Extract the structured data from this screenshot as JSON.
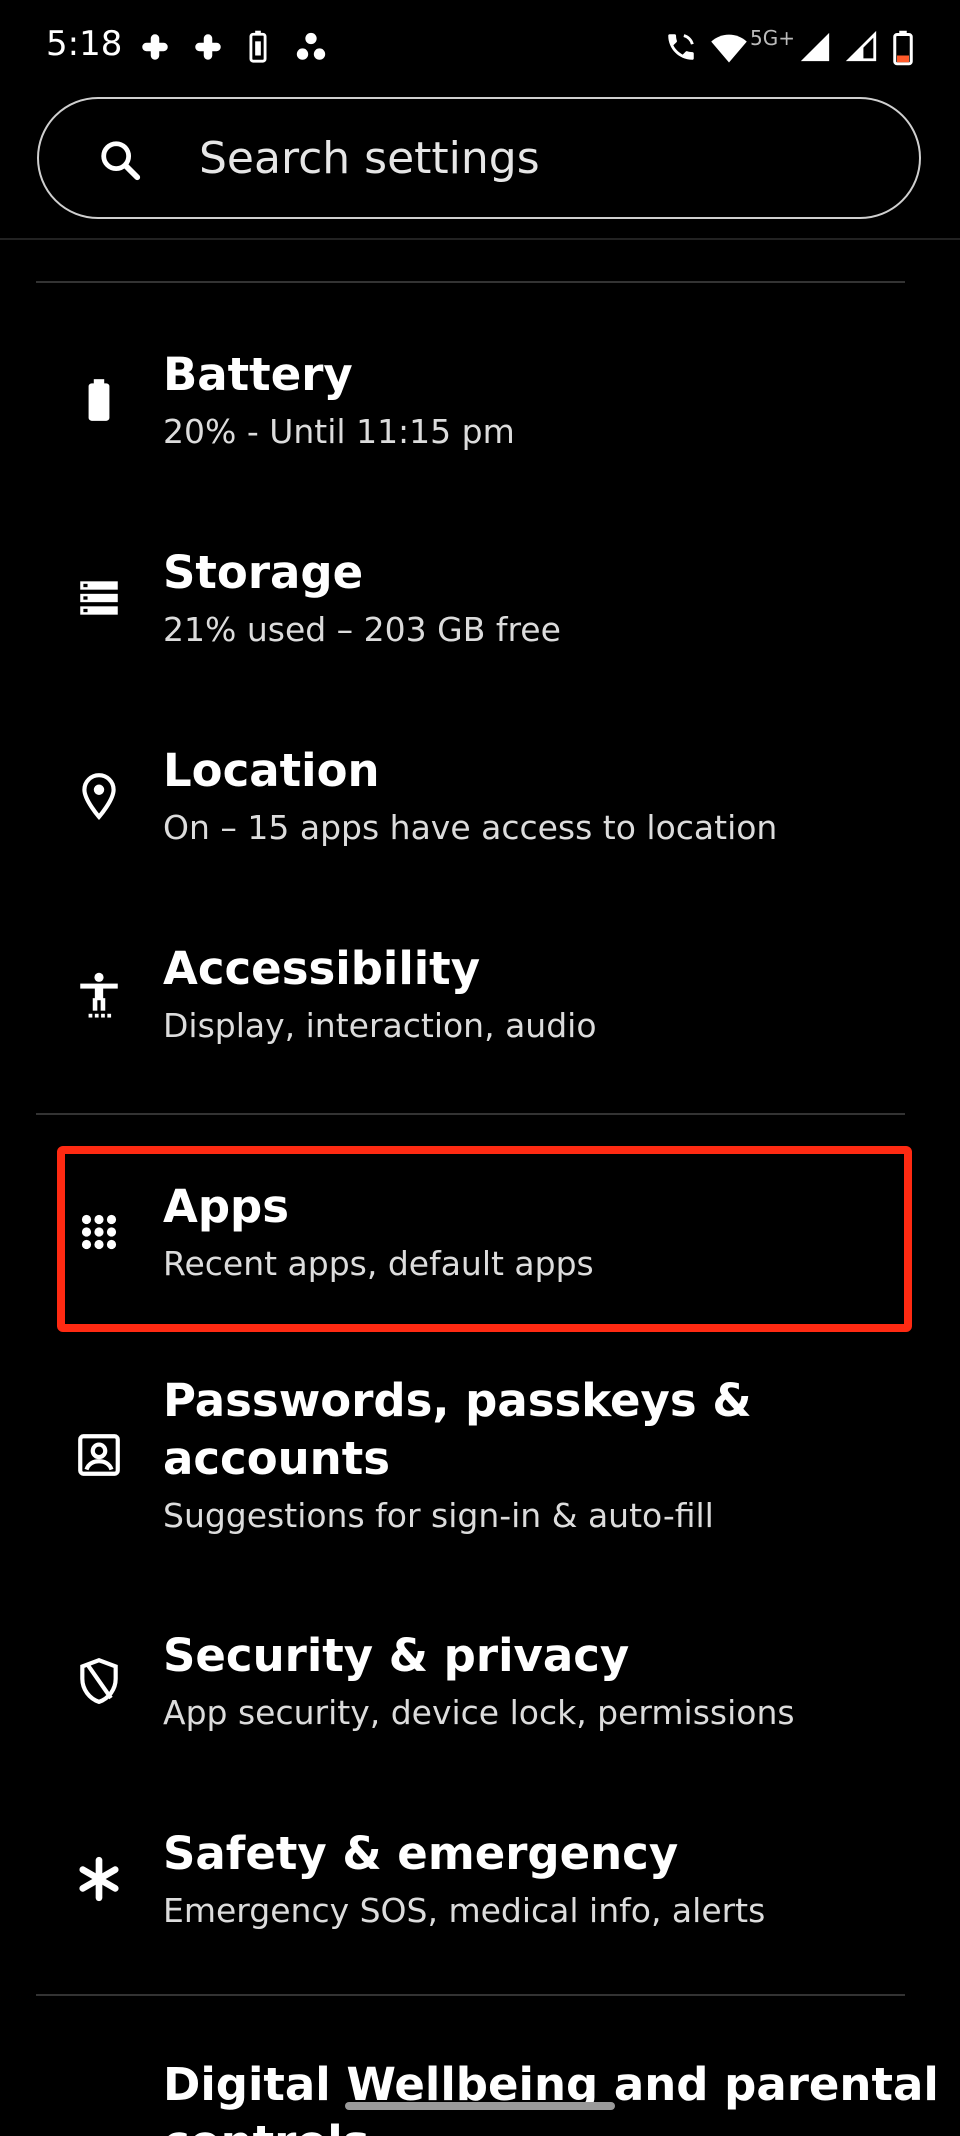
{
  "status_bar": {
    "time": "5:18",
    "network_label": "5G+",
    "icons": [
      "slack-icon",
      "slack-icon",
      "battery-saver-icon",
      "app-icon",
      "wifi-calling-icon",
      "wifi-icon",
      "signal-icon",
      "signal-icon",
      "battery-icon"
    ]
  },
  "search": {
    "placeholder": "Search settings",
    "icon": "search-icon"
  },
  "settings": [
    {
      "id": "battery",
      "icon": "battery-icon",
      "title": "Battery",
      "subtitle": "20% - Until 11:15 pm"
    },
    {
      "id": "storage",
      "icon": "storage-icon",
      "title": "Storage",
      "subtitle": "21% used – 203 GB free"
    },
    {
      "id": "location",
      "icon": "location-pin-icon",
      "title": "Location",
      "subtitle": "On – 15 apps have access to location"
    },
    {
      "id": "accessibility",
      "icon": "accessibility-icon",
      "title": "Accessibility",
      "subtitle": "Display, interaction, audio"
    },
    {
      "id": "apps",
      "icon": "apps-grid-icon",
      "title": "Apps",
      "subtitle": "Recent apps, default apps"
    },
    {
      "id": "passwords",
      "icon": "account-box-icon",
      "title_line1": "Passwords, passkeys &",
      "title_line2": "accounts",
      "subtitle": "Suggestions for sign-in & auto-fill"
    },
    {
      "id": "security",
      "icon": "shield-icon",
      "title": "Security & privacy",
      "subtitle": "App security, device lock, permissions"
    },
    {
      "id": "safety",
      "icon": "asterisk-icon",
      "title": "Safety & emergency",
      "subtitle": "Emergency SOS, medical info, alerts"
    },
    {
      "id": "wellbeing",
      "title_line1": "Digital Wellbeing and parental",
      "title_line2": "controls"
    }
  ],
  "colors": {
    "background": "#000000",
    "highlight": "#ff2a12",
    "divider": "#333333"
  }
}
